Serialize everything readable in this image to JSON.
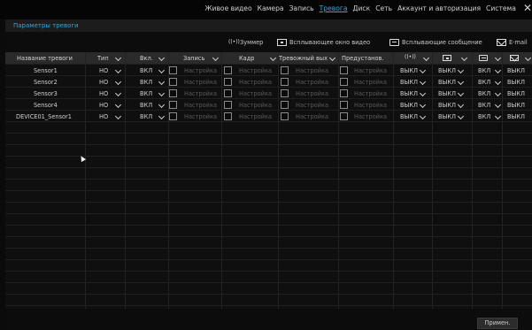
{
  "nav": {
    "items": [
      "Живое видео",
      "Камера",
      "Запись",
      "Тревога",
      "Диск",
      "Сеть",
      "Аккаунт и авторизация",
      "Система"
    ],
    "active": "Тревога",
    "close_glyph": "✕"
  },
  "page_title": "Параметры тревоги",
  "legend": {
    "buzzer_label": "Зуммер",
    "popup_label": "Всплывающее окно видео",
    "message_label": "Всплывающие сообщение",
    "email_label": "E-mail",
    "buzzer_glyph": "((•))"
  },
  "table": {
    "headers": {
      "name": "Название тревоги",
      "type": "Тип",
      "enable": "Вкл.",
      "record": "Запись",
      "snapshot": "Кадр",
      "alarm_out": "Тревожный вых",
      "preset": "Предустанов."
    },
    "rows": [
      {
        "name": "Sensor1",
        "type": "НО",
        "enable": "ВКЛ",
        "record": "Настройка",
        "snapshot": "Настройка",
        "alarm_out": "Настройка",
        "preset": "Настройка",
        "buzzer": "ВЫКЛ",
        "popup": "ВЫКЛ",
        "message": "ВКЛ",
        "email": "ВЫКЛ"
      },
      {
        "name": "Sensor2",
        "type": "НО",
        "enable": "ВКЛ",
        "record": "Настройка",
        "snapshot": "Настройка",
        "alarm_out": "Настройка",
        "preset": "Настройка",
        "buzzer": "ВЫКЛ",
        "popup": "ВЫКЛ",
        "message": "ВКЛ",
        "email": "ВЫКЛ"
      },
      {
        "name": "Sensor3",
        "type": "НО",
        "enable": "ВКЛ",
        "record": "Настройка",
        "snapshot": "Настройка",
        "alarm_out": "Настройка",
        "preset": "Настройка",
        "buzzer": "ВЫКЛ",
        "popup": "ВЫКЛ",
        "message": "ВКЛ",
        "email": "ВЫКЛ"
      },
      {
        "name": "Sensor4",
        "type": "НО",
        "enable": "ВКЛ",
        "record": "Настройка",
        "snapshot": "Настройка",
        "alarm_out": "Настройка",
        "preset": "Настройка",
        "buzzer": "ВЫКЛ",
        "popup": "ВЫКЛ",
        "message": "ВКЛ",
        "email": "ВЫКЛ"
      },
      {
        "name": "DEVICE01_Sensor1",
        "type": "НО",
        "enable": "ВКЛ",
        "record": "Настройка",
        "snapshot": "Настройка",
        "alarm_out": "Настройка",
        "preset": "Настройка",
        "buzzer": "ВЫКЛ",
        "popup": "ВЫКЛ",
        "message": "ВКЛ",
        "email": "ВЫКЛ"
      }
    ]
  },
  "apply_label": "Примен.",
  "colors": {
    "accent": "#3aa5d8",
    "background": "#0b0b0b",
    "header_bg": "#2a2a2a"
  }
}
